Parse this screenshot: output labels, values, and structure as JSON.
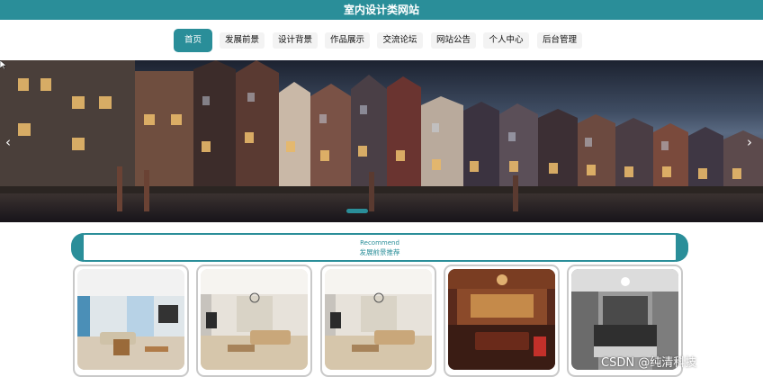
{
  "site": {
    "title": "室内设计类网站"
  },
  "nav": {
    "items": [
      {
        "label": "首页",
        "active": true
      },
      {
        "label": "发展前景"
      },
      {
        "label": "设计背景"
      },
      {
        "label": "作品展示"
      },
      {
        "label": "交流论坛"
      },
      {
        "label": "网站公告"
      },
      {
        "label": "个人中心"
      },
      {
        "label": "后台管理"
      }
    ]
  },
  "banner": {
    "prev_icon": "chevron-left-icon",
    "next_icon": "chevron-right-icon"
  },
  "recommend": {
    "title_en": "Recommend",
    "title_zh": "发展前景推荐"
  },
  "cards": [
    {
      "scene": "living-room-blue"
    },
    {
      "scene": "living-room-beige"
    },
    {
      "scene": "living-room-beige"
    },
    {
      "scene": "chinese-style-hall"
    },
    {
      "scene": "bedroom-dark"
    }
  ],
  "watermark": "CSDN @纯清科技",
  "colors": {
    "accent": "#2a8e99",
    "nav_bg": "#ffffff",
    "page_bg": "#f1f3f4"
  }
}
